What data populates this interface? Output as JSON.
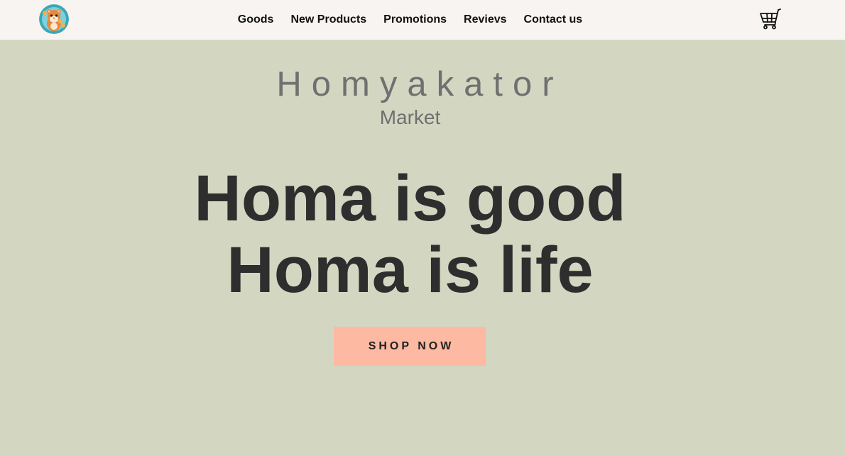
{
  "nav": {
    "logo_icon": "hamster-logo-icon",
    "links": [
      "Goods",
      "New Products",
      "Promotions",
      "Revievs",
      "Contact us"
    ],
    "cart_icon": "shopping-cart-icon"
  },
  "hero": {
    "brand": "Homyakator",
    "brand_sub": "Market",
    "headline_line1": "Homa is good",
    "headline_line2": "Homa is life",
    "cta_label": "SHOP NOW"
  },
  "colors": {
    "navbar_bg": "#f7f4f1",
    "hero_bg": "#d3d7c1",
    "headline": "#2e2e2e",
    "brand_text": "#707070",
    "cta_bg": "#fdb9a2"
  }
}
